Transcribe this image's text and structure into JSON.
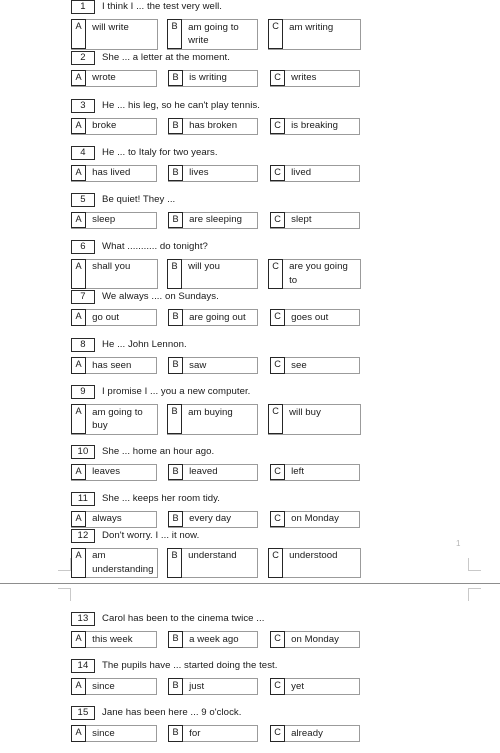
{
  "document": {
    "kind": "grammar-multiple-choice-test",
    "page_number": "1",
    "option_letters": [
      "A",
      "B",
      "C"
    ]
  },
  "page_one": {
    "questions": [
      {
        "number": "1",
        "prompt": "I think I ... the test very well.",
        "two_line": true,
        "options": [
          {
            "letter": "A",
            "text": "will write"
          },
          {
            "letter": "B",
            "text": "am going to write"
          },
          {
            "letter": "C",
            "text": "am writing"
          }
        ]
      },
      {
        "number": "2",
        "prompt": "She ... a letter at the moment.",
        "two_line": false,
        "options": [
          {
            "letter": "A",
            "text": "wrote"
          },
          {
            "letter": "B",
            "text": "is writing"
          },
          {
            "letter": "C",
            "text": "writes"
          }
        ]
      },
      {
        "number": "3",
        "prompt": "He ... his leg, so he can't play tennis.",
        "two_line": false,
        "options": [
          {
            "letter": "A",
            "text": "broke"
          },
          {
            "letter": "B",
            "text": "has broken"
          },
          {
            "letter": "C",
            "text": "is breaking"
          }
        ]
      },
      {
        "number": "4",
        "prompt": "He ... to Italy for two years.",
        "two_line": false,
        "options": [
          {
            "letter": "A",
            "text": "has lived"
          },
          {
            "letter": "B",
            "text": "lives"
          },
          {
            "letter": "C",
            "text": "lived"
          }
        ]
      },
      {
        "number": "5",
        "prompt": "Be quiet! They ...",
        "two_line": false,
        "options": [
          {
            "letter": "A",
            "text": "sleep"
          },
          {
            "letter": "B",
            "text": "are sleeping"
          },
          {
            "letter": "C",
            "text": "slept"
          }
        ]
      },
      {
        "number": "6",
        "prompt": "What ........... do tonight?",
        "two_line": true,
        "options": [
          {
            "letter": "A",
            "text": "shall you"
          },
          {
            "letter": "B",
            "text": "will you"
          },
          {
            "letter": "C",
            "text": "are you going to"
          }
        ]
      },
      {
        "number": "7",
        "prompt": "We always .... on Sundays.",
        "two_line": false,
        "options": [
          {
            "letter": "A",
            "text": "go out"
          },
          {
            "letter": "B",
            "text": "are going out"
          },
          {
            "letter": "C",
            "text": "goes out"
          }
        ]
      },
      {
        "number": "8",
        "prompt": "He ... John Lennon.",
        "two_line": false,
        "options": [
          {
            "letter": "A",
            "text": "has seen"
          },
          {
            "letter": "B",
            "text": "saw"
          },
          {
            "letter": "C",
            "text": "see"
          }
        ]
      },
      {
        "number": "9",
        "prompt": "I promise I ... you a new computer.",
        "two_line": true,
        "options": [
          {
            "letter": "A",
            "text": "am going to buy"
          },
          {
            "letter": "B",
            "text": "am buying"
          },
          {
            "letter": "C",
            "text": "will buy"
          }
        ]
      },
      {
        "number": "10",
        "prompt": "She ... home an hour ago.",
        "two_line": false,
        "options": [
          {
            "letter": "A",
            "text": "leaves"
          },
          {
            "letter": "B",
            "text": "leaved"
          },
          {
            "letter": "C",
            "text": "left"
          }
        ]
      },
      {
        "number": "11",
        "prompt": "She ... keeps her room tidy.",
        "two_line": false,
        "options": [
          {
            "letter": "A",
            "text": "always"
          },
          {
            "letter": "B",
            "text": "every day"
          },
          {
            "letter": "C",
            "text": "on Monday"
          }
        ]
      },
      {
        "number": "12",
        "prompt": "Don't worry. I ... it now.",
        "two_line": true,
        "options": [
          {
            "letter": "A",
            "text": "am understanding"
          },
          {
            "letter": "B",
            "text": "understand"
          },
          {
            "letter": "C",
            "text": "understood"
          }
        ]
      }
    ]
  },
  "page_two": {
    "questions": [
      {
        "number": "13",
        "prompt": "Carol has been to the cinema twice ...",
        "two_line": false,
        "options": [
          {
            "letter": "A",
            "text": "this week"
          },
          {
            "letter": "B",
            "text": "a week ago"
          },
          {
            "letter": "C",
            "text": "on Monday"
          }
        ]
      },
      {
        "number": "14",
        "prompt": "The pupils have ... started doing the test.",
        "two_line": false,
        "options": [
          {
            "letter": "A",
            "text": "since"
          },
          {
            "letter": "B",
            "text": "just"
          },
          {
            "letter": "C",
            "text": "yet"
          }
        ]
      },
      {
        "number": "15",
        "prompt": "Jane has been here ... 9 o'clock.",
        "two_line": false,
        "options": [
          {
            "letter": "A",
            "text": "since"
          },
          {
            "letter": "B",
            "text": "for"
          },
          {
            "letter": "C",
            "text": "already"
          }
        ]
      }
    ]
  }
}
